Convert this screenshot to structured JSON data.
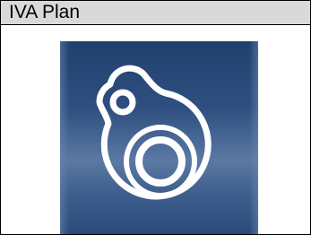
{
  "header": {
    "title": "IVA Plan"
  },
  "tile": {
    "icon": "iva-plan-app-icon",
    "colors": {
      "background_dark": "#21406e",
      "background_light": "#5b79a3",
      "glyph": "#ffffff",
      "header_fill": "#d9d9d9",
      "border": "#000000"
    }
  }
}
